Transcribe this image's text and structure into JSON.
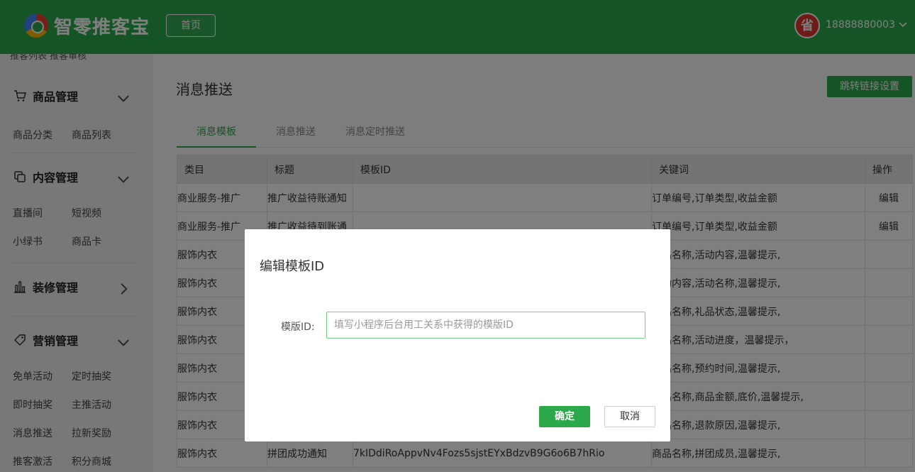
{
  "header": {
    "brand": "智零推客宝",
    "home_label": "首页",
    "avatar_text": "省",
    "phone": "18888880003",
    "accent": "#2aa84a"
  },
  "sidebar": {
    "cut_text": "推客列表   推客审核",
    "groups": [
      {
        "title": "商品管理",
        "icon": "cart-icon",
        "items": [
          "商品分类",
          "商品列表"
        ]
      },
      {
        "title": "内容管理",
        "icon": "content-icon",
        "items": [
          "直播间",
          "短视频",
          "小绿书",
          "商品卡"
        ]
      },
      {
        "title": "装修管理",
        "icon": "bar-chart-icon",
        "items": []
      },
      {
        "title": "营销管理",
        "icon": "tag-icon",
        "items": [
          "免单活动",
          "定时抽奖",
          "即时抽奖",
          "主推活动",
          "消息推送",
          "拉新奖励",
          "推客激活",
          "积分商城"
        ]
      }
    ]
  },
  "main": {
    "title": "消息推送",
    "jump_label": "跳转链接设置",
    "tabs": [
      "消息模板",
      "消息推送",
      "消息定时推送"
    ],
    "columns": [
      "类目",
      "标题",
      "模板ID",
      "关键词",
      "操作"
    ],
    "rows": [
      [
        "商业服务-推广",
        "推广收益待账通知",
        "",
        "订单编号,订单类型,收益金额",
        "编辑"
      ],
      [
        "商业服务-推广",
        "推广收益待到账通",
        "",
        "订单编号,订单类型,收益金额",
        "编辑"
      ],
      [
        "服饰内衣",
        "",
        "",
        "商品名称,活动内容,温馨提示,",
        ""
      ],
      [
        "服饰内衣",
        "",
        "",
        "活动内容,活动名称,温馨提示,",
        ""
      ],
      [
        "服饰内衣",
        "",
        "",
        "商品名称,礼品状态,温馨提示,",
        ""
      ],
      [
        "服饰内衣",
        "",
        "",
        "商品名称,活动进度，温馨提示，",
        ""
      ],
      [
        "服饰内衣",
        "",
        "",
        "商品名称,预约时间,温馨提示,",
        ""
      ],
      [
        "服饰内衣",
        "",
        "",
        "商品名称,商品金额,底价,温馨提示,",
        ""
      ],
      [
        "服饰内衣",
        "",
        "",
        "商品名称,退款原因,温馨提示,",
        ""
      ],
      [
        "服饰内衣",
        "拼团成功通知",
        "7kIDdiRoAppvNv4Fozs5sjstEYxBdzvB9G6o6B7hRio",
        "商品名称,拼团成员,温馨提示,",
        ""
      ]
    ]
  },
  "dialog": {
    "title": "编辑模板ID",
    "field_label": "模版ID:",
    "placeholder": "填写小程序后台用工关系中获得的模版ID",
    "value": "",
    "ok_label": "确定",
    "cancel_label": "取消"
  }
}
